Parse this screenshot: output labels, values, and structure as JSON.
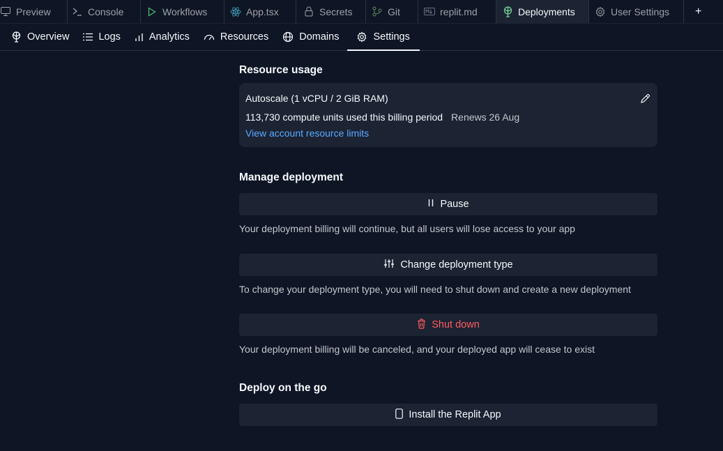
{
  "tabs": [
    {
      "label": "Preview",
      "icon": "monitor-icon"
    },
    {
      "label": "Console",
      "icon": "terminal-icon"
    },
    {
      "label": "Workflows",
      "icon": "play-icon"
    },
    {
      "label": "App.tsx",
      "icon": "react-icon"
    },
    {
      "label": "Secrets",
      "icon": "lock-icon"
    },
    {
      "label": "Git",
      "icon": "git-icon"
    },
    {
      "label": "replit.md",
      "icon": "markdown-icon"
    },
    {
      "label": "Deployments",
      "icon": "deployments-icon",
      "active": true
    },
    {
      "label": "User Settings",
      "icon": "gear-icon"
    }
  ],
  "add_tab_label": "+",
  "subnav": [
    {
      "label": "Overview",
      "icon": "deployments-icon"
    },
    {
      "label": "Logs",
      "icon": "list-icon"
    },
    {
      "label": "Analytics",
      "icon": "bar-chart-icon"
    },
    {
      "label": "Resources",
      "icon": "gauge-icon"
    },
    {
      "label": "Domains",
      "icon": "globe-icon"
    },
    {
      "label": "Settings",
      "icon": "gear-icon",
      "active": true
    }
  ],
  "resource_usage": {
    "title": "Resource usage",
    "machine": "Autoscale (1 vCPU / 2 GiB RAM)",
    "compute_units": "113,730 compute units used this billing period",
    "renews": "Renews 26 Aug",
    "limits_link": "View account resource limits"
  },
  "manage": {
    "title": "Manage deployment",
    "pause_label": "Pause",
    "pause_desc": "Your deployment billing will continue, but all users will lose access to your app",
    "change_type_label": "Change deployment type",
    "change_type_desc": "To change your deployment type, you will need to shut down and create a new deployment",
    "shutdown_label": "Shut down",
    "shutdown_desc": "Your deployment billing will be canceled, and your deployed app will cease to exist"
  },
  "mobile": {
    "title": "Deploy on the go",
    "install_label": "Install the Replit App"
  },
  "colors": {
    "background": "#0e1525",
    "surface": "#1c2333",
    "accent_link": "#57abff",
    "danger": "#ff5c5c",
    "deployments_icon": "#73d393"
  }
}
